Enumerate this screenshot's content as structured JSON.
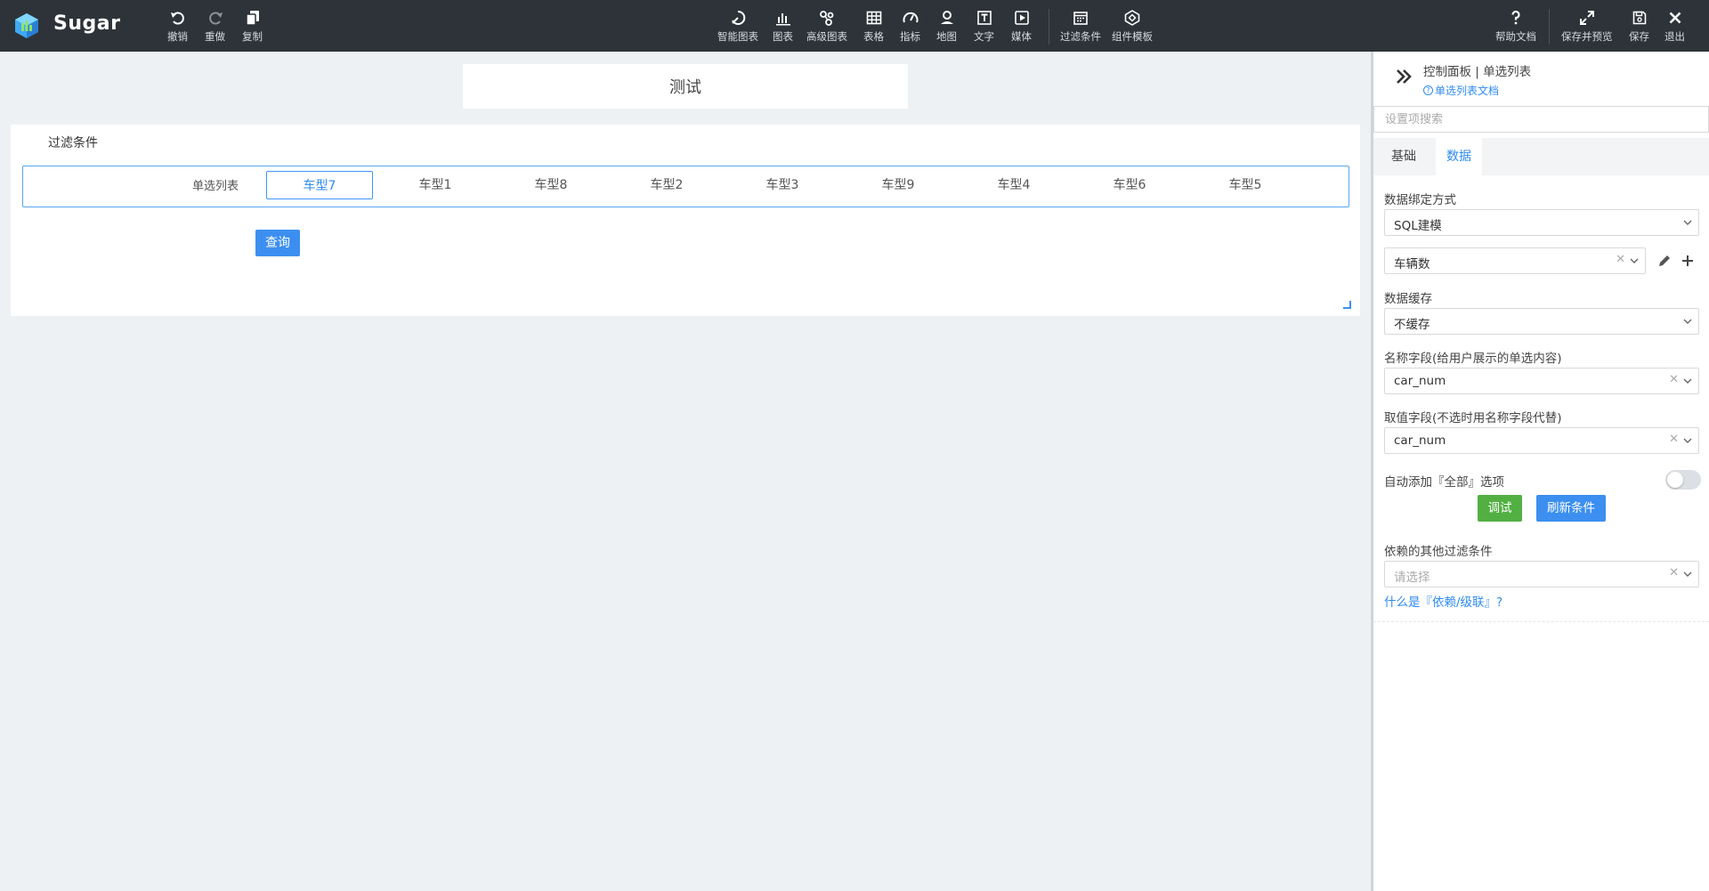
{
  "app": {
    "name": "Sugar"
  },
  "toolbar": {
    "history": [
      {
        "label": "撤销",
        "icon": "undo-icon"
      },
      {
        "label": "重做",
        "icon": "redo-icon"
      },
      {
        "label": "复制",
        "icon": "copy-icon"
      }
    ],
    "components": [
      {
        "label": "智能图表",
        "icon": "smart-chart-icon"
      },
      {
        "label": "图表",
        "icon": "bar-chart-icon"
      },
      {
        "label": "高级图表",
        "icon": "advanced-chart-icon"
      },
      {
        "label": "表格",
        "icon": "table-icon"
      },
      {
        "label": "指标",
        "icon": "gauge-icon"
      },
      {
        "label": "地图",
        "icon": "map-pin-icon"
      },
      {
        "label": "文字",
        "icon": "text-icon"
      },
      {
        "label": "媒体",
        "icon": "media-play-icon"
      },
      {
        "label": "过滤条件",
        "icon": "filter-calendar-icon"
      },
      {
        "label": "组件模板",
        "icon": "template-icon"
      }
    ],
    "actions": [
      {
        "label": "帮助文档",
        "icon": "help-icon"
      },
      {
        "label": "保存并预览",
        "icon": "expand-icon"
      },
      {
        "label": "保存",
        "icon": "save-icon"
      },
      {
        "label": "退出",
        "icon": "close-icon"
      }
    ]
  },
  "canvas": {
    "title": "测试",
    "filter": {
      "title": "过滤条件",
      "row_label": "单选列表",
      "options": [
        "车型7",
        "车型1",
        "车型8",
        "车型2",
        "车型3",
        "车型9",
        "车型4",
        "车型6",
        "车型5"
      ],
      "selected": "车型7",
      "query_button": "查询"
    }
  },
  "panel": {
    "heading": "控制面板 | 单选列表",
    "doc_link": "单选列表文档",
    "search_placeholder": "设置项搜索",
    "tabs": [
      {
        "label": "基础",
        "active": false
      },
      {
        "label": "数据",
        "active": true
      }
    ],
    "binding": {
      "label": "数据绑定方式",
      "value": "SQL建模",
      "model": "车辆数"
    },
    "cache": {
      "label": "数据缓存",
      "value": "不缓存"
    },
    "name_field": {
      "label": "名称字段(给用户展示的单选内容)",
      "value": "car_num"
    },
    "value_field": {
      "label": "取值字段(不选时用名称字段代替)",
      "value": "car_num"
    },
    "auto_all": {
      "label": "自动添加『全部』选项",
      "enabled": false
    },
    "debug_button": "调试",
    "refresh_button": "刷新条件",
    "dependency": {
      "label": "依赖的其他过滤条件",
      "placeholder": "请选择"
    },
    "help_link": "什么是『依赖/级联』?"
  },
  "colors": {
    "toolbar_bg": "#2d3339",
    "accent": "#3c8ff0",
    "debug_green": "#52b043",
    "canvas_bg": "#eef1f3"
  }
}
